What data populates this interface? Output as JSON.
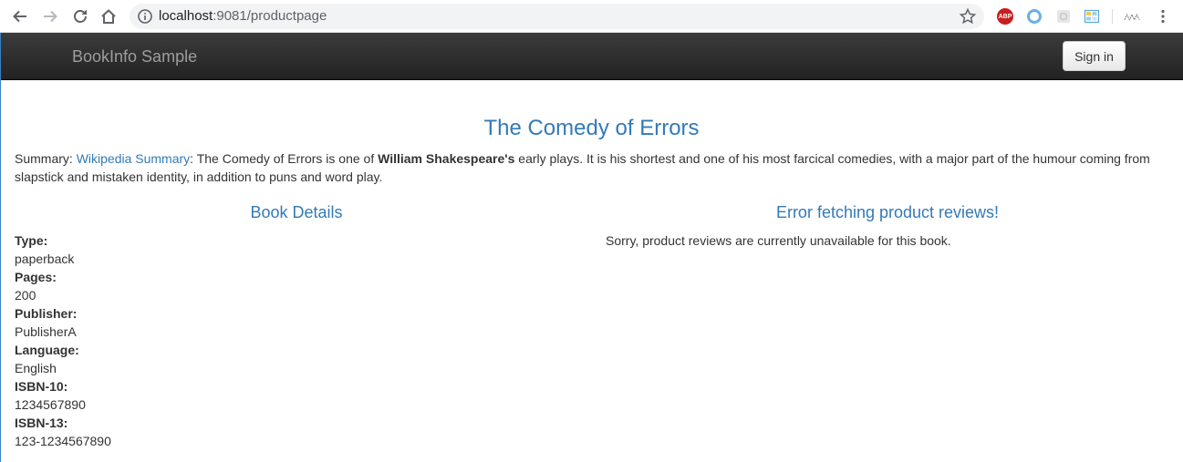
{
  "browser": {
    "url_host": "localhost",
    "url_path": ":9081/productpage",
    "abp_label": "ABP",
    "colors": {
      "abp": "#c81e1e",
      "link": "#337ab7"
    }
  },
  "navbar": {
    "brand": "BookInfo Sample",
    "signin_label": "Sign in"
  },
  "product": {
    "title": "The Comedy of Errors",
    "summary_prefix": "Summary: ",
    "summary_link": "Wikipedia Summary",
    "summary_text_1": ": The Comedy of Errors is one of ",
    "summary_bold": "William Shakespeare's",
    "summary_text_2": " early plays. It is his shortest and one of his most farcical comedies, with a major part of the humour coming from slapstick and mistaken identity, in addition to puns and word play."
  },
  "details": {
    "heading": "Book Details",
    "items": [
      {
        "label": "Type:",
        "value": "paperback"
      },
      {
        "label": "Pages:",
        "value": "200"
      },
      {
        "label": "Publisher:",
        "value": "PublisherA"
      },
      {
        "label": "Language:",
        "value": "English"
      },
      {
        "label": "ISBN-10:",
        "value": "1234567890"
      },
      {
        "label": "ISBN-13:",
        "value": "123-1234567890"
      }
    ]
  },
  "reviews": {
    "heading": "Error fetching product reviews!",
    "message": "Sorry, product reviews are currently unavailable for this book."
  }
}
